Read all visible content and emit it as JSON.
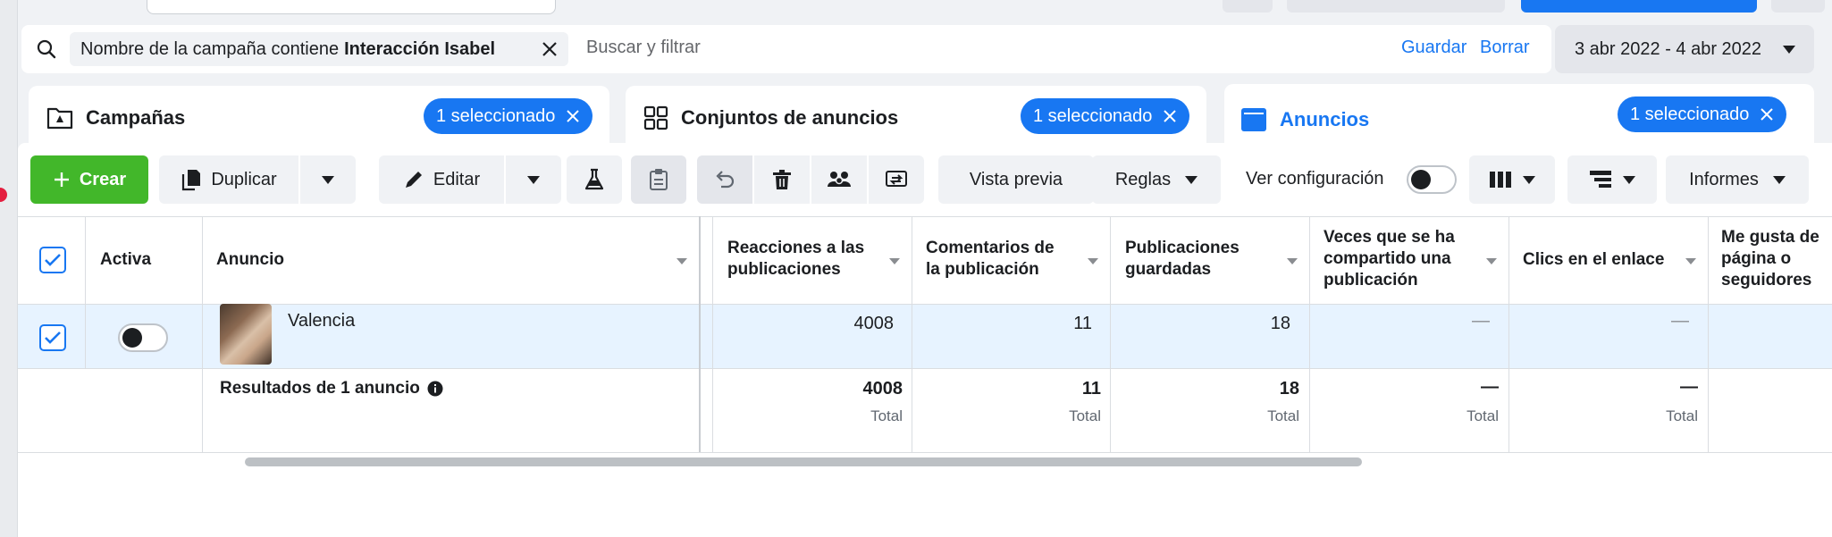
{
  "filter": {
    "chip_prefix": "Nombre de la campaña contiene",
    "chip_value": "Interacción Isabel",
    "search_placeholder": "Buscar y filtrar",
    "save_label": "Guardar",
    "clear_label": "Borrar",
    "date_range": "3 abr 2022 - 4 abr 2022"
  },
  "tabs": [
    {
      "label": "Campañas",
      "selected": "1 seleccionado"
    },
    {
      "label": "Conjuntos de anuncios",
      "selected": "1 seleccionado"
    },
    {
      "label": "Anuncios",
      "selected": "1 seleccionado"
    }
  ],
  "toolbar": {
    "create": "Crear",
    "duplicate": "Duplicar",
    "edit": "Editar",
    "preview": "Vista previa",
    "rules": "Reglas",
    "view_config": "Ver configuración",
    "reports": "Informes"
  },
  "table": {
    "headers": {
      "active": "Activa",
      "ad": "Anuncio",
      "reactions": [
        "Reacciones a las",
        "publicaciones"
      ],
      "comments": [
        "Comentarios de",
        "la publicación"
      ],
      "saved": [
        "Publicaciones",
        "guardadas"
      ],
      "shares": [
        "Veces que se ha",
        "compartido una",
        "publicación"
      ],
      "clicks": "Clics en el enlace",
      "likes": [
        "Me gusta de",
        "página o",
        "seguidores"
      ]
    },
    "row": {
      "name": "Valencia",
      "reactions": "4008",
      "comments": "11",
      "saved": "18",
      "shares": "—",
      "clicks": "—"
    },
    "totals": {
      "label": "Resultados de 1 anuncio",
      "reactions": "4008",
      "comments": "11",
      "saved": "18",
      "shares": "—",
      "clicks": "—",
      "total_word": "Total"
    }
  },
  "colors": {
    "primary": "#1877f2",
    "create_green": "#42b72a"
  }
}
